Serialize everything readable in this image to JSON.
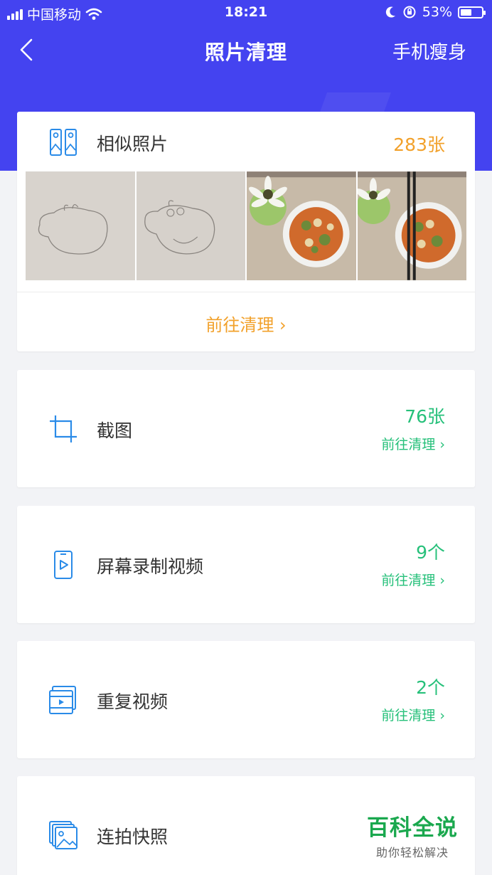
{
  "colors": {
    "header": "#4443f0",
    "orange": "#f2a12b",
    "green": "#26c07a",
    "icon_blue": "#2a8be8"
  },
  "status_bar": {
    "carrier": "中国移动",
    "time": "18:21",
    "battery": "53%",
    "battery_level": 0.53
  },
  "nav": {
    "title": "照片清理",
    "action": "手机瘦身",
    "back_icon": "chevron-left-icon"
  },
  "similar": {
    "label": "相似照片",
    "count": "283张",
    "goto": "前往清理 ›",
    "icon": "similar-photos-icon",
    "thumbnails": [
      "pig-sketch-1",
      "pig-sketch-2",
      "food-bowl-1",
      "food-bowl-chopsticks"
    ]
  },
  "screenshot": {
    "label": "截图",
    "count": "76张",
    "goto": "前往清理 ›",
    "icon": "crop-icon"
  },
  "screen_recording": {
    "label": "屏幕录制视频",
    "count": "9个",
    "goto": "前往清理 ›",
    "icon": "phone-video-icon"
  },
  "duplicate_video": {
    "label": "重复视频",
    "count": "2个",
    "goto": "前往清理 ›",
    "icon": "film-icon"
  },
  "burst": {
    "label": "连拍快照",
    "icon": "burst-photos-icon"
  },
  "watermark": {
    "brand": "百科全说",
    "sub": "助你轻松解决"
  }
}
